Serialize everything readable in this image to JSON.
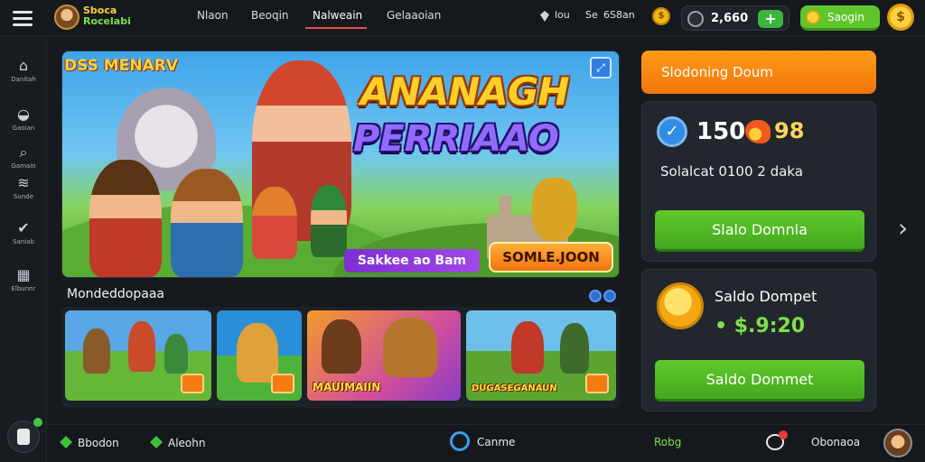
{
  "header": {
    "logo_line1": "Sboca",
    "logo_line2": "Rocelabi",
    "tabs": [
      {
        "label": "Nlaon"
      },
      {
        "label": "Beoqin"
      },
      {
        "label": "Nalweain",
        "active": true
      },
      {
        "label": "Gelaaoian"
      }
    ],
    "stat_small": "lou",
    "stat_se": "Se",
    "stat_value": "6S8an",
    "balance": "2,660",
    "deposit_label": "Saogin"
  },
  "sidebar": {
    "items": [
      {
        "label": "Danitah",
        "icon": "home-icon"
      },
      {
        "label": "Gaoian",
        "icon": "controller-icon"
      },
      {
        "label": "Gamain",
        "icon": "search-icon"
      },
      {
        "label": "Sunde",
        "icon": "layers-icon"
      },
      {
        "label": "Saniab",
        "icon": "badge-icon"
      },
      {
        "label": "Elbunnr",
        "icon": "grid-icon"
      }
    ]
  },
  "banner": {
    "corner_text": "DSS MENARV",
    "title": "ANANAGH",
    "subtitle": "PERRIAAO",
    "purple_btn": "Sakkee ao Bam",
    "orange_btn": "SOMLE.JOON"
  },
  "games": {
    "section_title": "Mondeddopaaa",
    "cards": [
      {
        "label": ""
      },
      {
        "label": ""
      },
      {
        "label": "MAUIMAIIN"
      },
      {
        "label": "DUGASEGANAUN"
      }
    ]
  },
  "right_panel": {
    "promo_label": "Slodoning Doum",
    "stat_number": "150",
    "stat_suffix": "98",
    "info_text": "Solalcat 0100 2 daka",
    "button1_label": "Slalo Domnla",
    "wallet_label": "Saldo Dompet",
    "wallet_value": "• $.9:20",
    "button2_label": "Saldo Dommet"
  },
  "bottombar": {
    "items": [
      {
        "label": "Bbodon"
      },
      {
        "label": "Aleohn"
      },
      {
        "label": "Canme"
      },
      {
        "label": "Robg"
      },
      {
        "label": "Obonaoa"
      }
    ]
  },
  "colors": {
    "accent_green": "#5ec52a",
    "accent_orange": "#f1750a",
    "tab_underline": "#e94b4b",
    "background": "#161a1f"
  }
}
